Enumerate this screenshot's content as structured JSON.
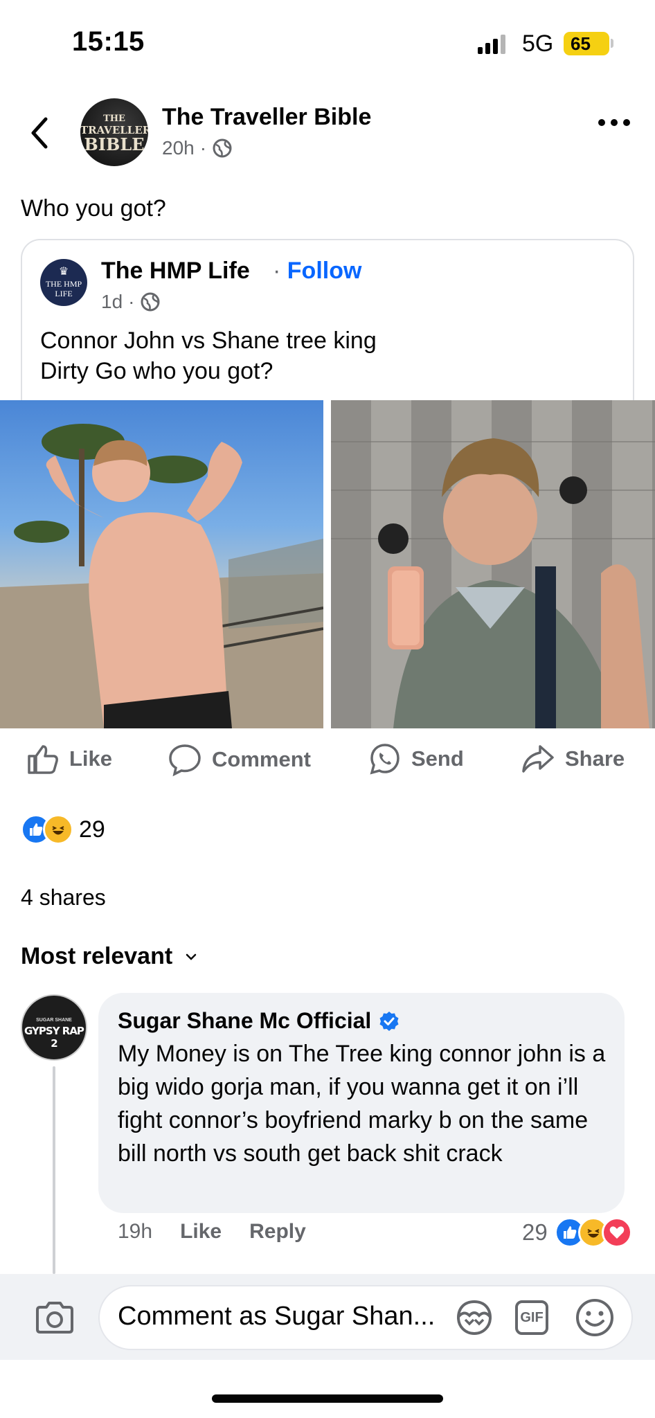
{
  "status_bar": {
    "time": "15:15",
    "network": "5G",
    "battery": "65"
  },
  "header": {
    "page_name": "The Traveller Bible",
    "time": "20h",
    "avatar_text": [
      "THE",
      "TRAVELLER",
      "BIBLE"
    ]
  },
  "post": {
    "text": "Who you got?"
  },
  "shared": {
    "page_name": "The HMP Life",
    "follow_label": "Follow",
    "time": "1d",
    "avatar_text": [
      "THE HMP",
      "LIFE"
    ],
    "text": "Connor John vs Shane tree king\nDirty Go who you got?"
  },
  "actions": {
    "like": "Like",
    "comment": "Comment",
    "send": "Send",
    "share": "Share"
  },
  "reactions": {
    "count": "29"
  },
  "shares": "4 shares",
  "sort": "Most relevant",
  "comment": {
    "author": "Sugar Shane Mc Official",
    "avatar_text": [
      "SUGAR SHANE",
      "GYPSY RAP 2"
    ],
    "text": "My Money is on The Tree king connor john is a big wido gorja man, if you wanna get it on i’ll fight connor’s boyfriend marky b on the same bill north vs south get back shit crack",
    "time": "19h",
    "like": "Like",
    "reply": "Reply",
    "reaction_count": "29"
  },
  "composer": {
    "placeholder": "Comment as Sugar Shan...",
    "gif": "GIF"
  },
  "colors": {
    "facebook_blue": "#0866ff",
    "muted": "#65676b",
    "bubble": "#f0f2f5",
    "battery": "#f5d012"
  }
}
